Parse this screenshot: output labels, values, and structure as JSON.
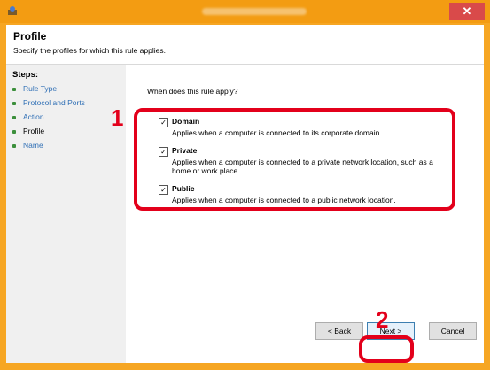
{
  "window": {
    "close_glyph": "✕",
    "icon": "firewall-app-icon"
  },
  "header": {
    "title": "Profile",
    "subtitle": "Specify the profiles for which this rule applies."
  },
  "steps": {
    "title": "Steps:",
    "items": [
      {
        "label": "Rule Type"
      },
      {
        "label": "Protocol and Ports"
      },
      {
        "label": "Action"
      },
      {
        "label": "Profile"
      },
      {
        "label": "Name"
      }
    ]
  },
  "content": {
    "question": "When does this rule apply?",
    "options": [
      {
        "label": "Domain",
        "checked": true,
        "check_glyph": "✓",
        "description": "Applies when a computer is connected to its corporate domain."
      },
      {
        "label": "Private",
        "checked": true,
        "check_glyph": "✓",
        "description": "Applies when a computer is connected to a private network location, such as a home or work place."
      },
      {
        "label": "Public",
        "checked": true,
        "check_glyph": "✓",
        "description": "Applies when a computer is connected to a public network location."
      }
    ]
  },
  "buttons": {
    "back_prefix": "< ",
    "back_access": "B",
    "back_rest": "ack",
    "next_access": "N",
    "next_rest": "ext >",
    "cancel": "Cancel"
  },
  "callouts": {
    "one": "1",
    "two": "2",
    "color": "#e3001b"
  }
}
